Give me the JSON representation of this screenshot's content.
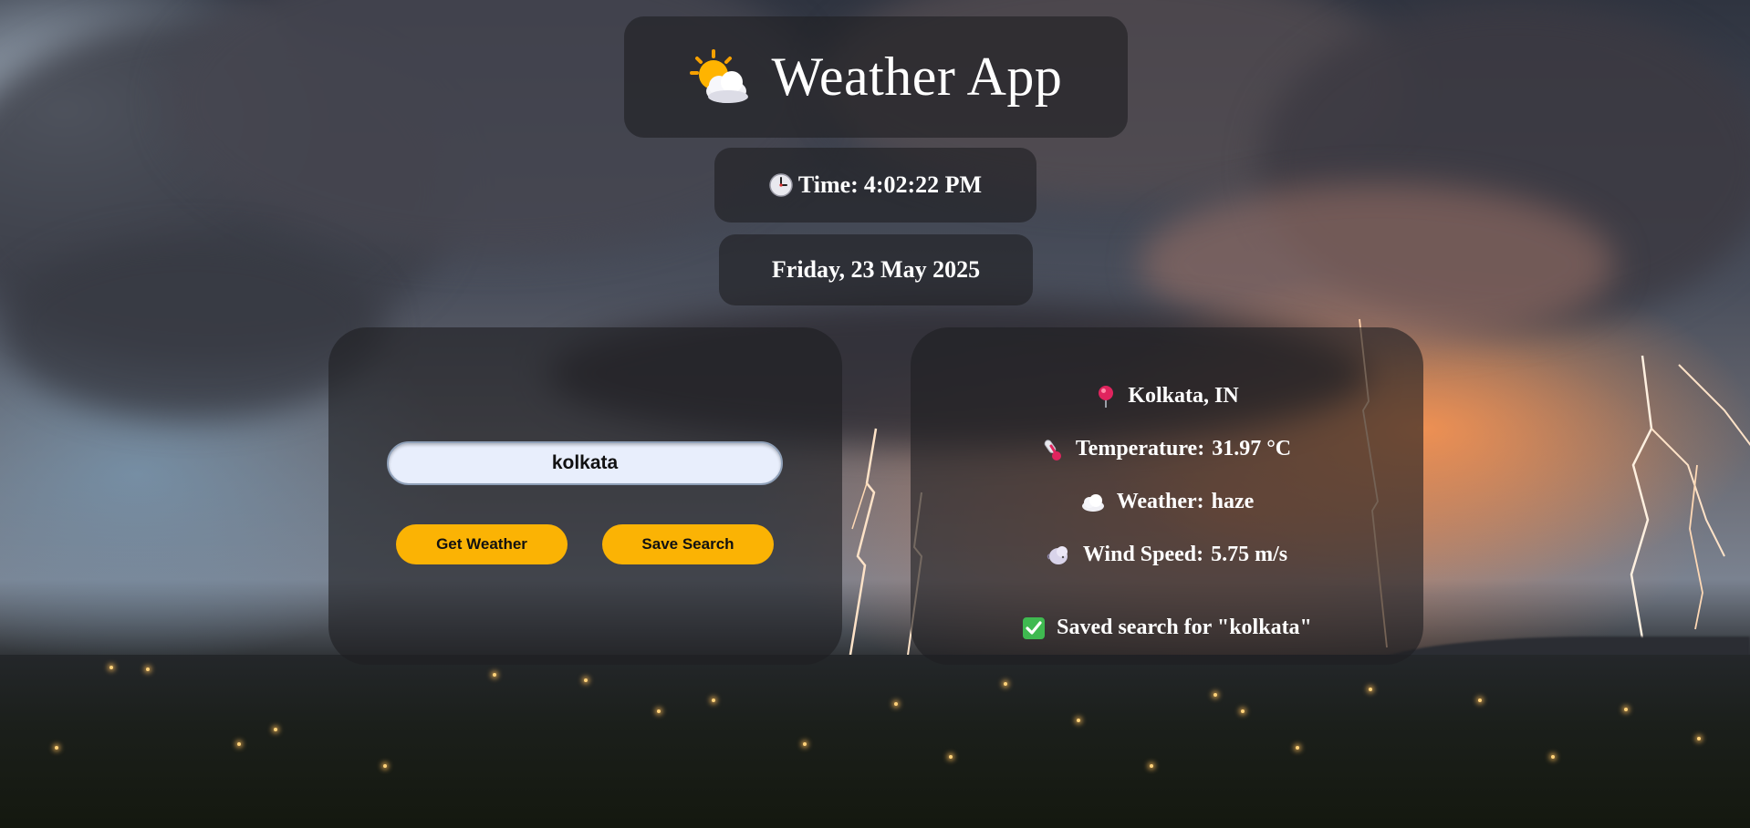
{
  "app": {
    "title": "Weather App",
    "title_icon": "sun-behind-cloud-icon"
  },
  "clock": {
    "time_label": "Time:",
    "time_value": "4:02:22 PM",
    "icon": "clock-icon"
  },
  "date": {
    "value": "Friday, 23 May 2025"
  },
  "search": {
    "input_value": "kolkata",
    "get_weather_label": "Get Weather",
    "save_search_label": "Save Search"
  },
  "result": {
    "location": "Kolkata, IN",
    "temperature_label": "Temperature:",
    "temperature_value": "31.97 °C",
    "weather_label": "Weather:",
    "weather_value": "haze",
    "wind_label": "Wind Speed:",
    "wind_value": "5.75 m/s",
    "saved_message": "Saved search for \"kolkata\"",
    "icons": [
      "round-pushpin-icon",
      "thermometer-icon",
      "cloud-icon",
      "wind-face-icon",
      "check-mark-icon"
    ]
  },
  "colors": {
    "button_bg": "#fbb304",
    "input_bg": "#e8eefc",
    "panel_bg": "rgba(30,30,34,0.62)",
    "check_green": "#3fb950",
    "pin_red": "#e0245e"
  }
}
